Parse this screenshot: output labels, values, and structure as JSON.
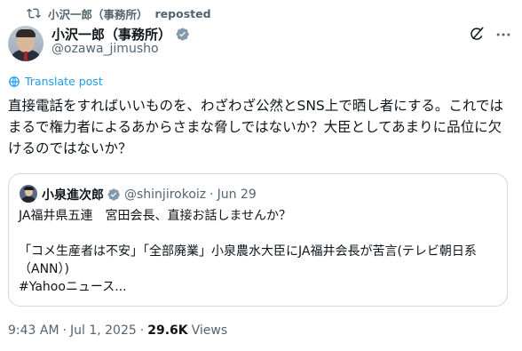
{
  "repost": {
    "reposter": "小沢一郎（事務所）",
    "action": "reposted"
  },
  "author": {
    "name": "小沢一郎（事務所）",
    "handle": "@ozawa_jimusho"
  },
  "translate_label": "Translate post",
  "post_text": "直接電話をすればいいものを、わざわざ公然とSNS上で晒し者にする。これではまるで権力者によるあからさまな脅しではないか？大臣としてあまりに品位に欠けるのではないか？",
  "quote": {
    "name": "小泉進次郎",
    "handle": "@shinjirokoiz",
    "separator": "·",
    "date": "Jun 29",
    "text": "JA福井県五連　宮田会長、直接お話しませんか？\n\n「コメ生産者は不安」「全部廃業」小泉農水大臣にJA福井会長が苦言(テレビ朝日系（ANN）)\n#Yahooニュース..."
  },
  "footer": {
    "time": "9:43 AM",
    "separator": "·",
    "date": "Jul 1, 2025",
    "views_count": "29.6K",
    "views_label": "Views"
  },
  "colors": {
    "accent": "#1d9bf0",
    "secondary_text": "#536471",
    "border": "#cfd9de"
  },
  "icons": [
    "repost-icon",
    "verified-badge-icon",
    "grok-icon",
    "more-icon",
    "translate-icon"
  ]
}
